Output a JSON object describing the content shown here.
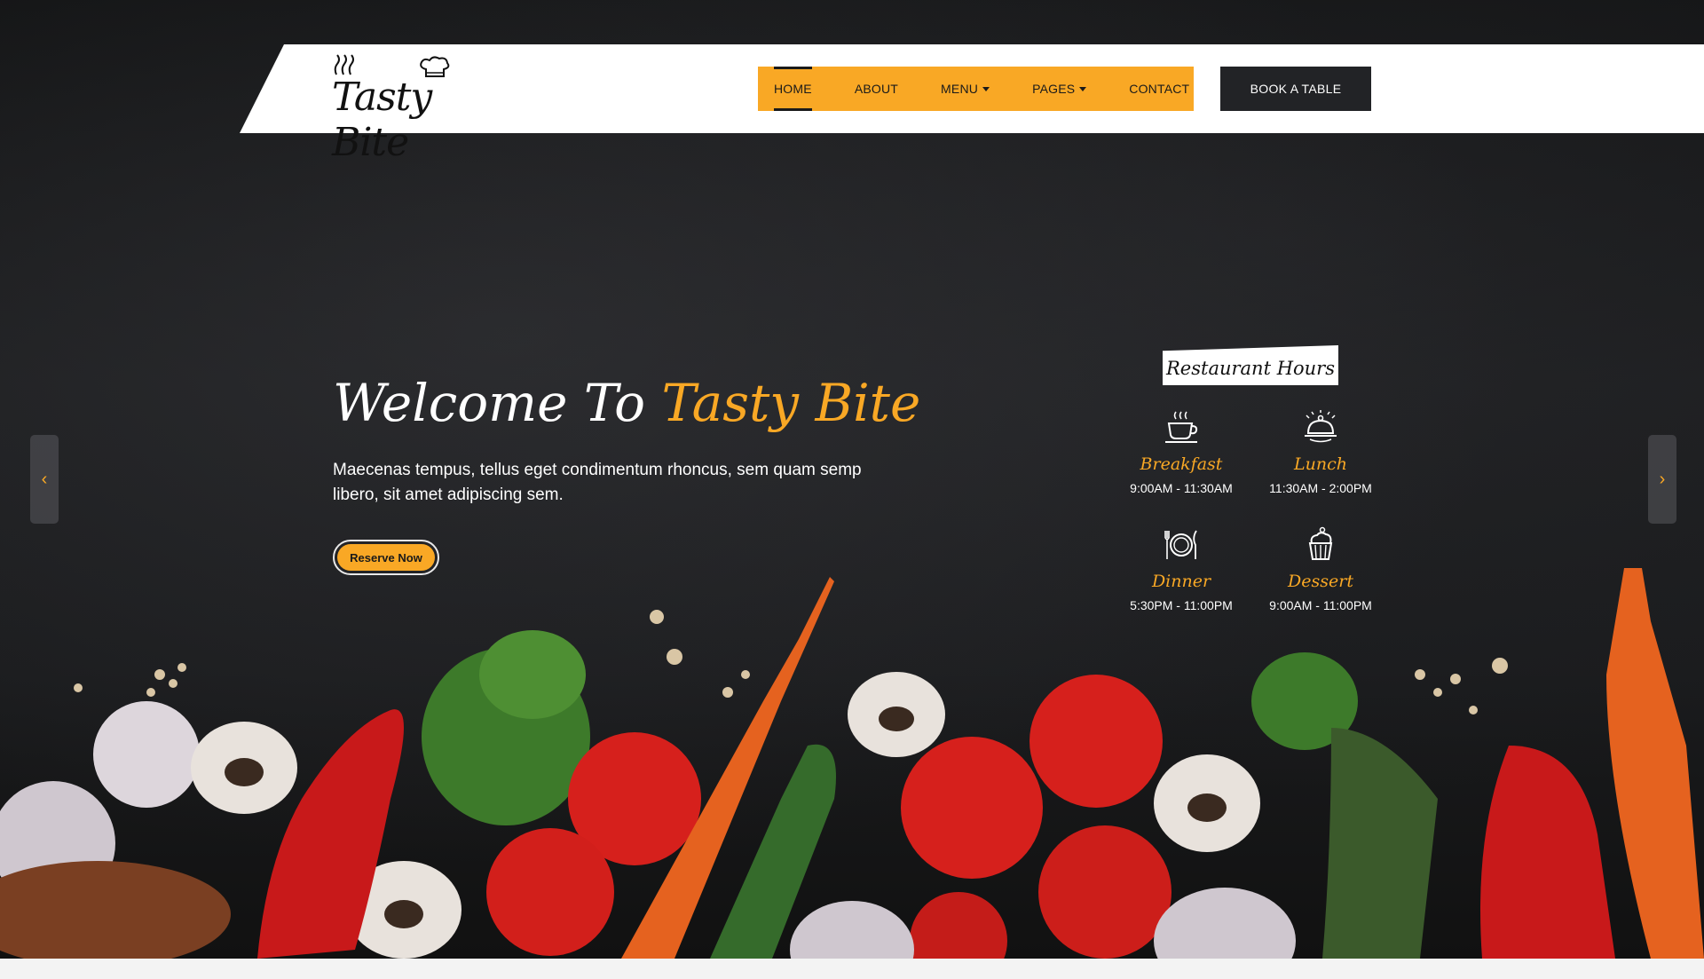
{
  "header": {
    "logo_text": "Tasty Bite",
    "nav": [
      {
        "label": "HOME",
        "active": true,
        "dropdown": false
      },
      {
        "label": "ABOUT",
        "active": false,
        "dropdown": false
      },
      {
        "label": "MENU",
        "active": false,
        "dropdown": true
      },
      {
        "label": "PAGES",
        "active": false,
        "dropdown": true
      },
      {
        "label": "CONTACT",
        "active": false,
        "dropdown": false
      }
    ],
    "book_label": "BOOK A TABLE"
  },
  "hero": {
    "welcome_prefix": "Welcome To",
    "welcome_brand": "Tasty Bite",
    "description": "Maecenas tempus, tellus eget condimentum rhoncus, sem quam semp libero, sit amet adipiscing sem.",
    "reserve_label": "Reserve Now"
  },
  "hours": {
    "title": "Restaurant Hours",
    "items": [
      {
        "name": "Breakfast",
        "time": "9:00AM - 11:30AM",
        "icon": "coffee-cup-icon"
      },
      {
        "name": "Lunch",
        "time": "11:30AM - 2:00PM",
        "icon": "serving-dish-icon"
      },
      {
        "name": "Dinner",
        "time": "5:30PM - 11:00PM",
        "icon": "plate-cutlery-icon"
      },
      {
        "name": "Dessert",
        "time": "9:00AM - 11:00PM",
        "icon": "cupcake-icon"
      }
    ]
  },
  "colors": {
    "accent": "#f9a825",
    "dark": "#222326",
    "hero_bg": "#1a1b1d"
  }
}
